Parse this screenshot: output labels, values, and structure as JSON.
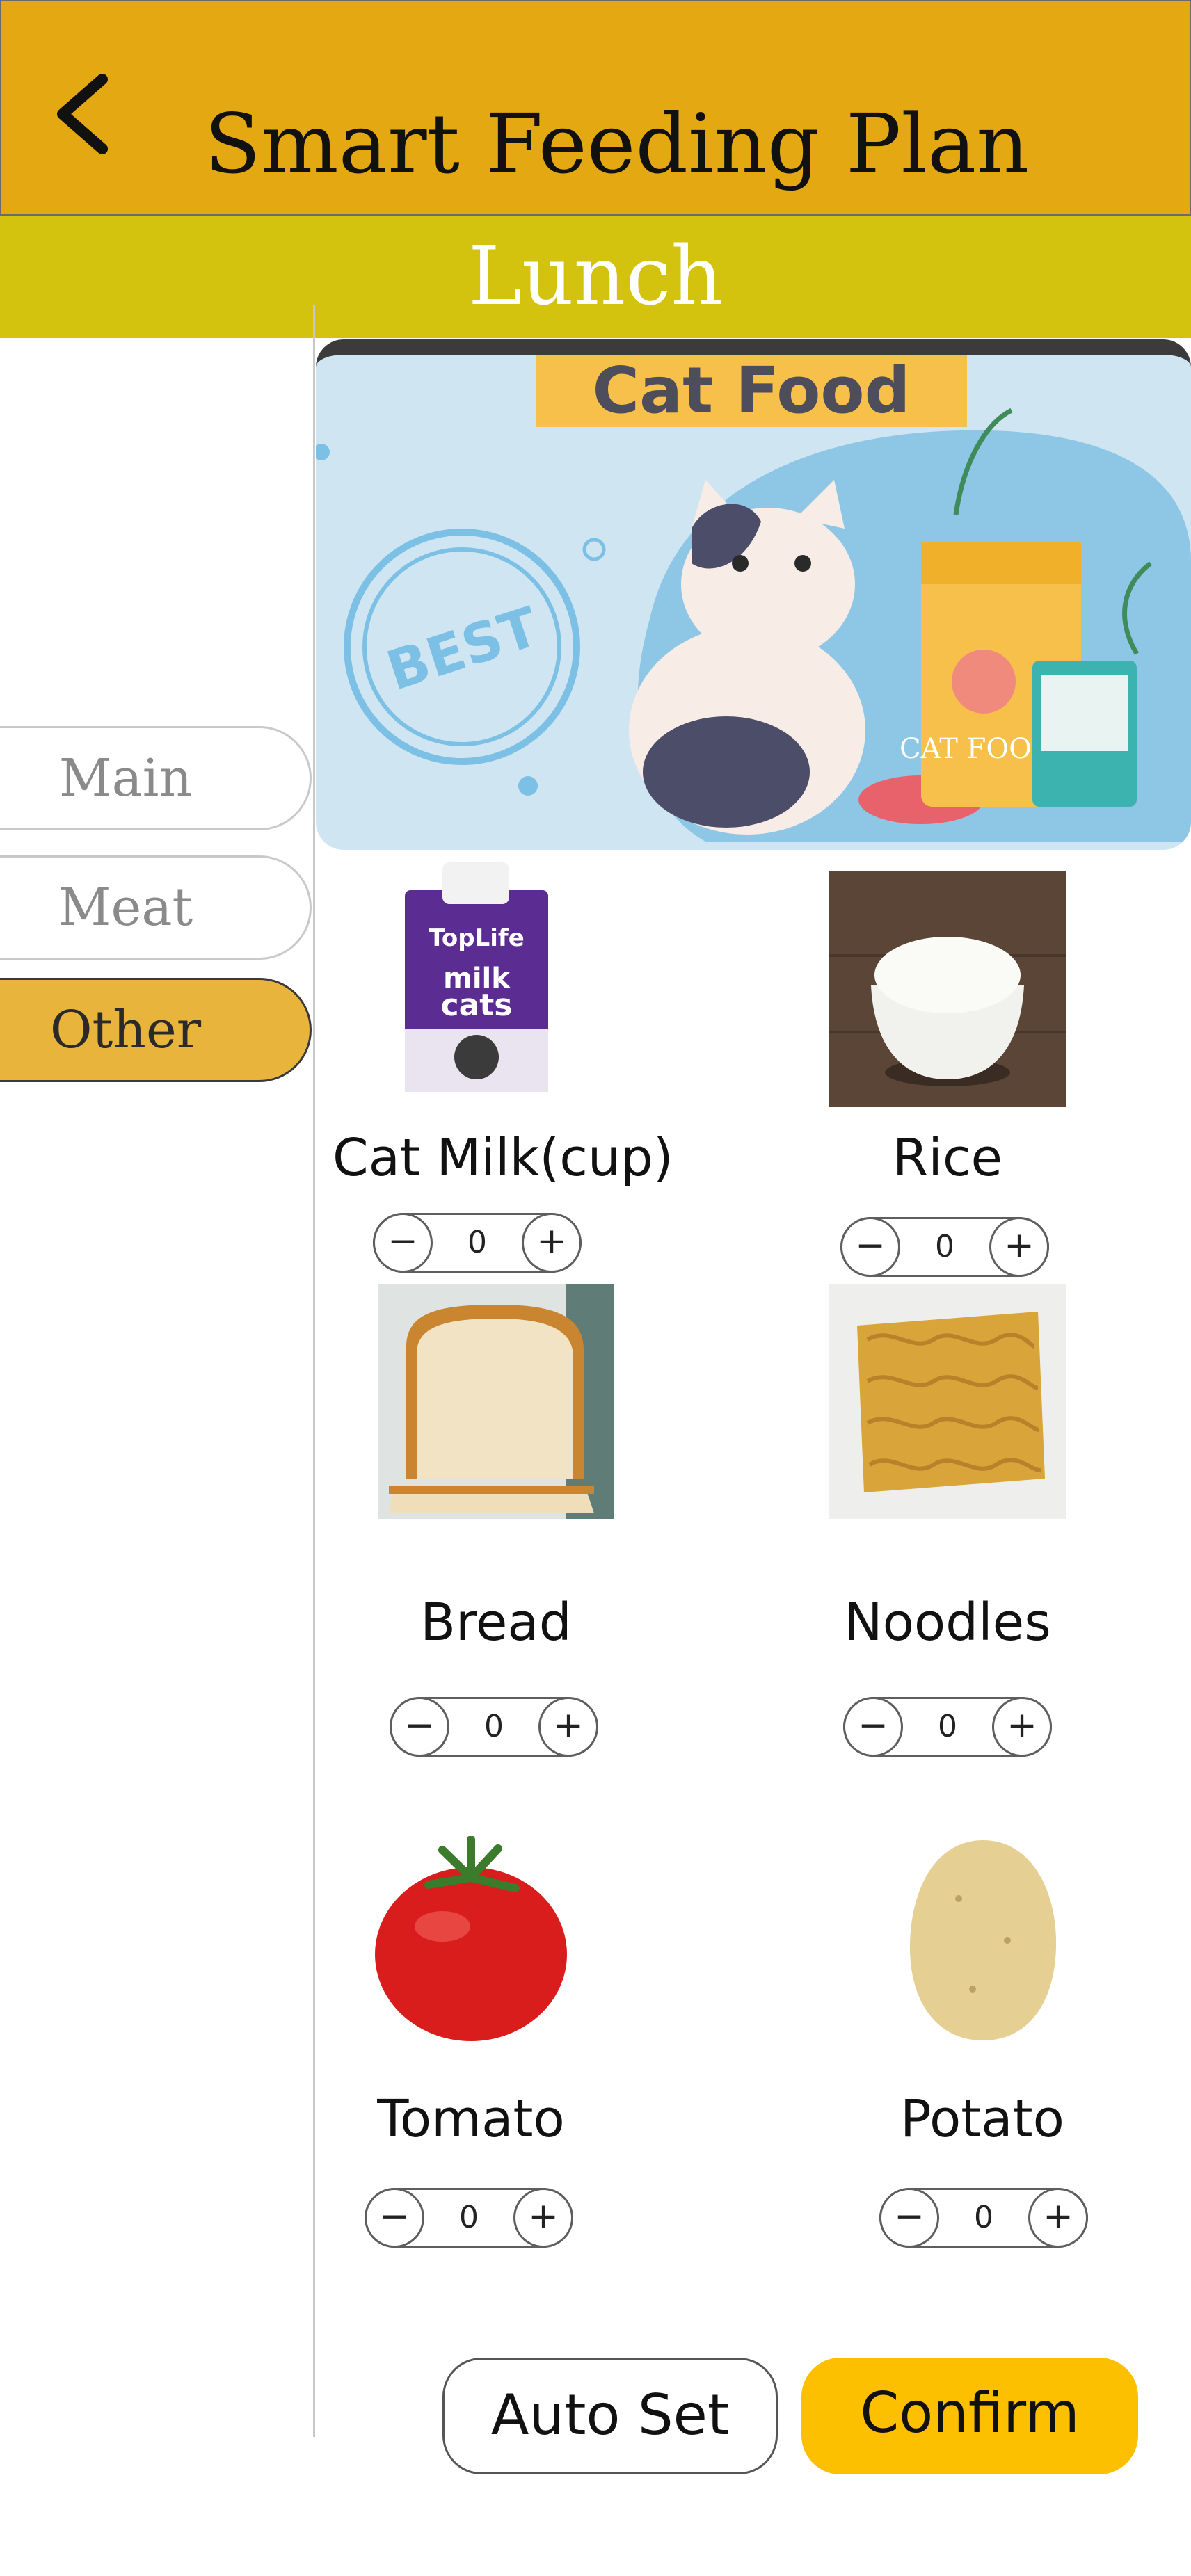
{
  "header": {
    "title": "Smart Feeding Plan"
  },
  "meal": {
    "name": "Lunch"
  },
  "categories": [
    {
      "label": "Main",
      "active": false
    },
    {
      "label": "Meat",
      "active": false
    },
    {
      "label": "Other",
      "active": true
    }
  ],
  "banner": {
    "label": "Cat Food",
    "stamp_text": "BEST",
    "bag_text": "CAT FOOD"
  },
  "foods": [
    {
      "name": "Cat Milk(cup)",
      "quantity": "0",
      "pack_brand": "TopLife",
      "pack_line1": "milk",
      "pack_line2": "cats"
    },
    {
      "name": "Rice",
      "quantity": "0"
    },
    {
      "name": "Bread",
      "quantity": "0"
    },
    {
      "name": "Noodles",
      "quantity": "0"
    },
    {
      "name": "Tomato",
      "quantity": "0"
    },
    {
      "name": "Potato",
      "quantity": "0"
    }
  ],
  "stepper": {
    "minus": "−",
    "plus": "+"
  },
  "actions": {
    "auto_set": "Auto Set",
    "confirm": "Confirm"
  },
  "colors": {
    "header": "#e4a812",
    "meal_bar": "#d3c30f",
    "active_tab": "#e8b43c",
    "confirm": "#fdc000"
  }
}
